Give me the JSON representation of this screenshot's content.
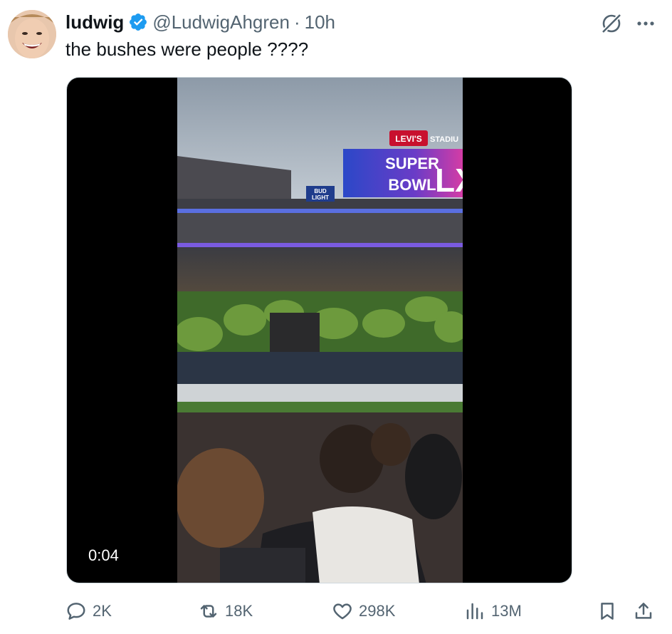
{
  "author": {
    "name": "ludwig",
    "handle": "@LudwigAhgren",
    "separator": "·",
    "time": "10h"
  },
  "tweet": {
    "text": "the bushes were people ????"
  },
  "video": {
    "duration": "0:04",
    "scene_text": {
      "levis": "LEVI'S",
      "stadium": "STADIU",
      "superbowl_line1": "SUPER",
      "superbowl_line2": "BOWL",
      "superbowl_numeral": "LX",
      "bud_line1": "BUD",
      "bud_line2": "LIGHT"
    }
  },
  "actions": {
    "replies": "2K",
    "reposts": "18K",
    "likes": "298K",
    "views": "13M"
  },
  "icons": {
    "verified": "verified-badge-icon",
    "grok": "grok-icon",
    "more": "more-icon",
    "reply": "reply-icon",
    "repost": "repost-icon",
    "like": "heart-icon",
    "views": "views-icon",
    "bookmark": "bookmark-icon",
    "share": "share-icon"
  },
  "colors": {
    "verified_blue": "#1d9bf0",
    "secondary_text": "#536471",
    "primary_text": "#0f1419"
  }
}
